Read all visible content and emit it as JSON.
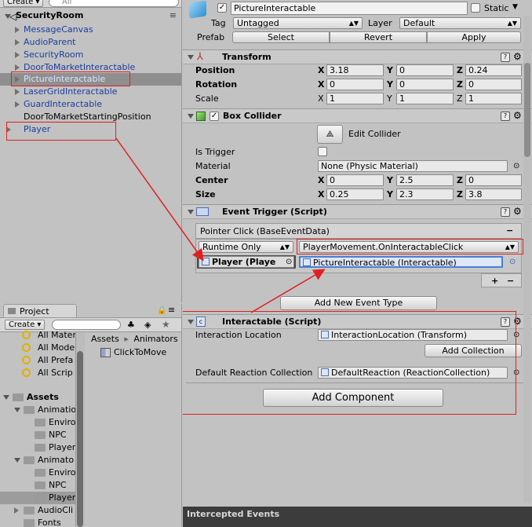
{
  "hierarchy": {
    "create_label": "Create",
    "search_placeholder": "All",
    "scene_name": "SecurityRoom",
    "items": [
      {
        "label": "MessageCanvas"
      },
      {
        "label": "AudioParent"
      },
      {
        "label": "SecurityRoom"
      },
      {
        "label": "DoorToMarketInteractable"
      },
      {
        "label": "PictureInteractable"
      },
      {
        "label": "LaserGridInteractable"
      },
      {
        "label": "GuardInteractable"
      },
      {
        "label": "DoorToMarketStartingPosition"
      },
      {
        "label": "Player"
      }
    ]
  },
  "project": {
    "tab_label": "Project",
    "create_label": "Create",
    "favorites": [
      {
        "label": "All Mater"
      },
      {
        "label": "All Mode"
      },
      {
        "label": "All Prefa"
      },
      {
        "label": "All Scrip"
      }
    ],
    "tree": [
      {
        "label": "Assets"
      },
      {
        "label": "Animatio"
      },
      {
        "label": "Enviro"
      },
      {
        "label": "NPC"
      },
      {
        "label": "Player"
      },
      {
        "label": "Animato"
      },
      {
        "label": "Enviro"
      },
      {
        "label": "NPC"
      },
      {
        "label": "Player"
      },
      {
        "label": "AudioCli"
      },
      {
        "label": "Fonts"
      }
    ],
    "breadcrumb": [
      "Assets",
      "Animators"
    ],
    "files": [
      {
        "label": "ClickToMove"
      }
    ]
  },
  "inspector": {
    "object_name": "PictureInteractable",
    "static_label": "Static",
    "tag_label": "Tag",
    "tag_value": "Untagged",
    "layer_label": "Layer",
    "layer_value": "Default",
    "prefab_label": "Prefab",
    "prefab_buttons": [
      "Select",
      "Revert",
      "Apply"
    ],
    "transform": {
      "title": "Transform",
      "position_label": "Position",
      "rotation_label": "Rotation",
      "scale_label": "Scale",
      "position": {
        "x": "3.18",
        "y": "0",
        "z": "0.24"
      },
      "rotation": {
        "x": "0",
        "y": "0",
        "z": "0"
      },
      "scale": {
        "x": "1",
        "y": "1",
        "z": "1"
      }
    },
    "box_collider": {
      "title": "Box Collider",
      "edit_label": "Edit Collider",
      "is_trigger_label": "Is Trigger",
      "material_label": "Material",
      "material_value": "None (Physic Material)",
      "center_label": "Center",
      "size_label": "Size",
      "center": {
        "x": "0",
        "y": "2.5",
        "z": "0"
      },
      "size": {
        "x": "0.25",
        "y": "2.3",
        "z": "3.8"
      }
    },
    "event_trigger": {
      "title": "Event Trigger (Script)",
      "event_header": "Pointer Click (BaseEventData)",
      "remove_symbol": "−",
      "runtime_value": "Runtime Only",
      "function_value": "PlayerMovement.OnInteractableClick",
      "target_value": "Player (Playe",
      "argument_value": "PictureInteractable (Interactable)",
      "add_symbol": "+",
      "minus_symbol": "−",
      "add_event_label": "Add New Event Type"
    },
    "interactable": {
      "title": "Interactable (Script)",
      "location_label": "Interaction Location",
      "location_value": "InteractionLocation (Transform)",
      "add_collection_label": "Add Collection",
      "default_label": "Default Reaction Collection",
      "default_value": "DefaultReaction (ReactionCollection)"
    },
    "add_component_label": "Add Component",
    "axis": {
      "x": "X",
      "y": "Y",
      "z": "Z"
    },
    "intercepted_label": "Intercepted Events"
  }
}
